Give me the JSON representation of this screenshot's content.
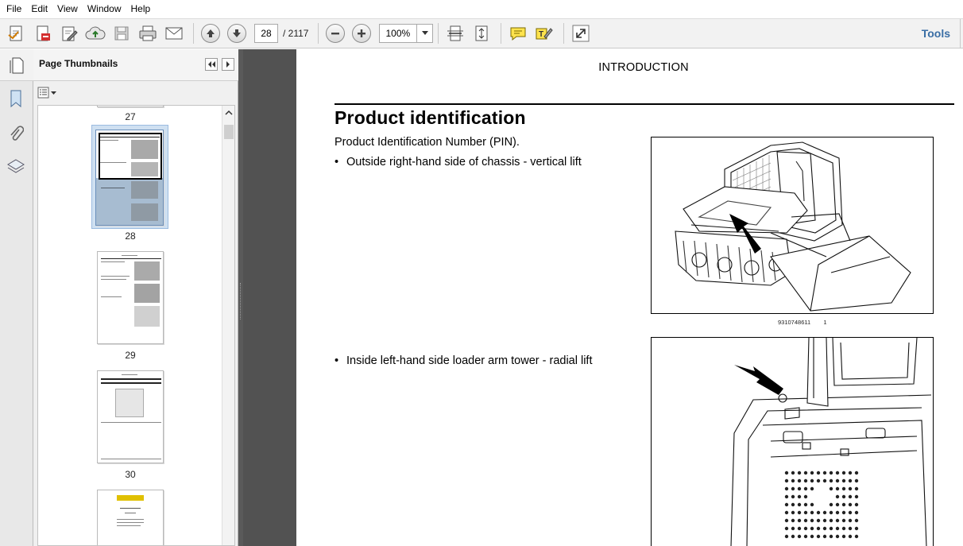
{
  "menu": [
    "File",
    "Edit",
    "View",
    "Window",
    "Help"
  ],
  "toolbar": {
    "page_current": "28",
    "page_total": "/ 2117",
    "zoom": "100%",
    "tools_label": "Tools"
  },
  "panel": {
    "title": "Page Thumbnails",
    "thumbnails": [
      {
        "label": "27"
      },
      {
        "label": "28",
        "selected": true
      },
      {
        "label": "29"
      },
      {
        "label": "30"
      }
    ]
  },
  "document": {
    "running_head": "INTRODUCTION",
    "heading": "Product identification",
    "intro": "Product Identification Number (PIN).",
    "bullet_1": "Outside right-hand side of chassis - vertical lift",
    "bullet_2": "Inside left-hand side loader arm tower - radial lift",
    "figure_1_caption": "9310748611",
    "figure_1_number": "1"
  },
  "icons": [
    "create-pdf-icon",
    "export-pdf-icon",
    "edit-pdf-icon",
    "upload-icon",
    "save-icon",
    "print-icon",
    "email-icon",
    "prev-page-icon",
    "next-page-icon",
    "zoom-out-icon",
    "zoom-in-icon",
    "fit-width-icon",
    "fit-page-icon",
    "comment-icon",
    "highlight-icon",
    "expand-icon"
  ]
}
